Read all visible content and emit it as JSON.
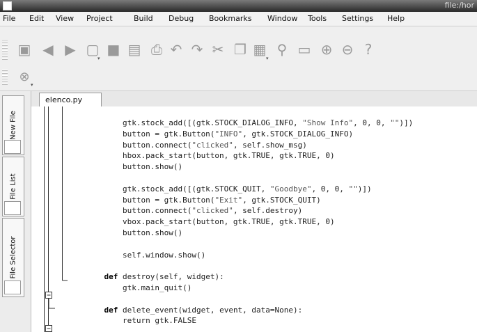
{
  "window": {
    "title": "file:/hor"
  },
  "menu": [
    "File",
    "Edit",
    "View",
    "Project",
    "Build",
    "Debug",
    "Bookmarks",
    "Window",
    "Tools",
    "Settings",
    "Help"
  ],
  "toolbar": {
    "icons": [
      "new-file-icon",
      "back-icon",
      "forward-icon",
      "open-file-icon",
      "save-icon",
      "save-all-icon",
      "print-icon",
      "undo-icon",
      "redo-icon",
      "cut-icon",
      "copy-icon",
      "paste-icon",
      "find-icon",
      "replace-icon",
      "zoom-in-icon",
      "zoom-out-icon",
      "context-help-icon"
    ],
    "stop_icon": "stop-icon"
  },
  "sidebar": {
    "tabs": [
      "New File",
      "File List",
      "File Selector"
    ]
  },
  "editor": {
    "tab_label": "elenco.py",
    "lines": [
      [
        "",
        "        gtk.stock_add([(gtk.STOCK_DIALOG_INFO, \"Show Info\", 0, 0, \"\")])"
      ],
      [
        "",
        "        button = gtk.Button(\"INFO\", gtk.STOCK_DIALOG_INFO)"
      ],
      [
        "",
        "        button.connect(\"clicked\", self.show_msg)"
      ],
      [
        "",
        "        hbox.pack_start(button, gtk.TRUE, gtk.TRUE, 0)"
      ],
      [
        "",
        "        button.show()"
      ],
      [
        "",
        ""
      ],
      [
        "",
        "        gtk.stock_add([(gtk.STOCK_QUIT, \"Goodbye\", 0, 0, \"\")])"
      ],
      [
        "",
        "        button = gtk.Button(\"Exit\", gtk.STOCK_QUIT)"
      ],
      [
        "",
        "        button.connect(\"clicked\", self.destroy)"
      ],
      [
        "",
        "        vbox.pack_start(button, gtk.TRUE, gtk.TRUE, 0)"
      ],
      [
        "",
        "        button.show()"
      ],
      [
        "",
        ""
      ],
      [
        "",
        "        self.window.show()"
      ],
      [
        "",
        ""
      ],
      [
        "def",
        "    def destroy(self, widget):"
      ],
      [
        "",
        "        gtk.main_quit()"
      ],
      [
        "",
        ""
      ],
      [
        "def",
        "    def delete_event(widget, event, data=None):"
      ],
      [
        "",
        "        return gtk.FALSE"
      ]
    ]
  }
}
